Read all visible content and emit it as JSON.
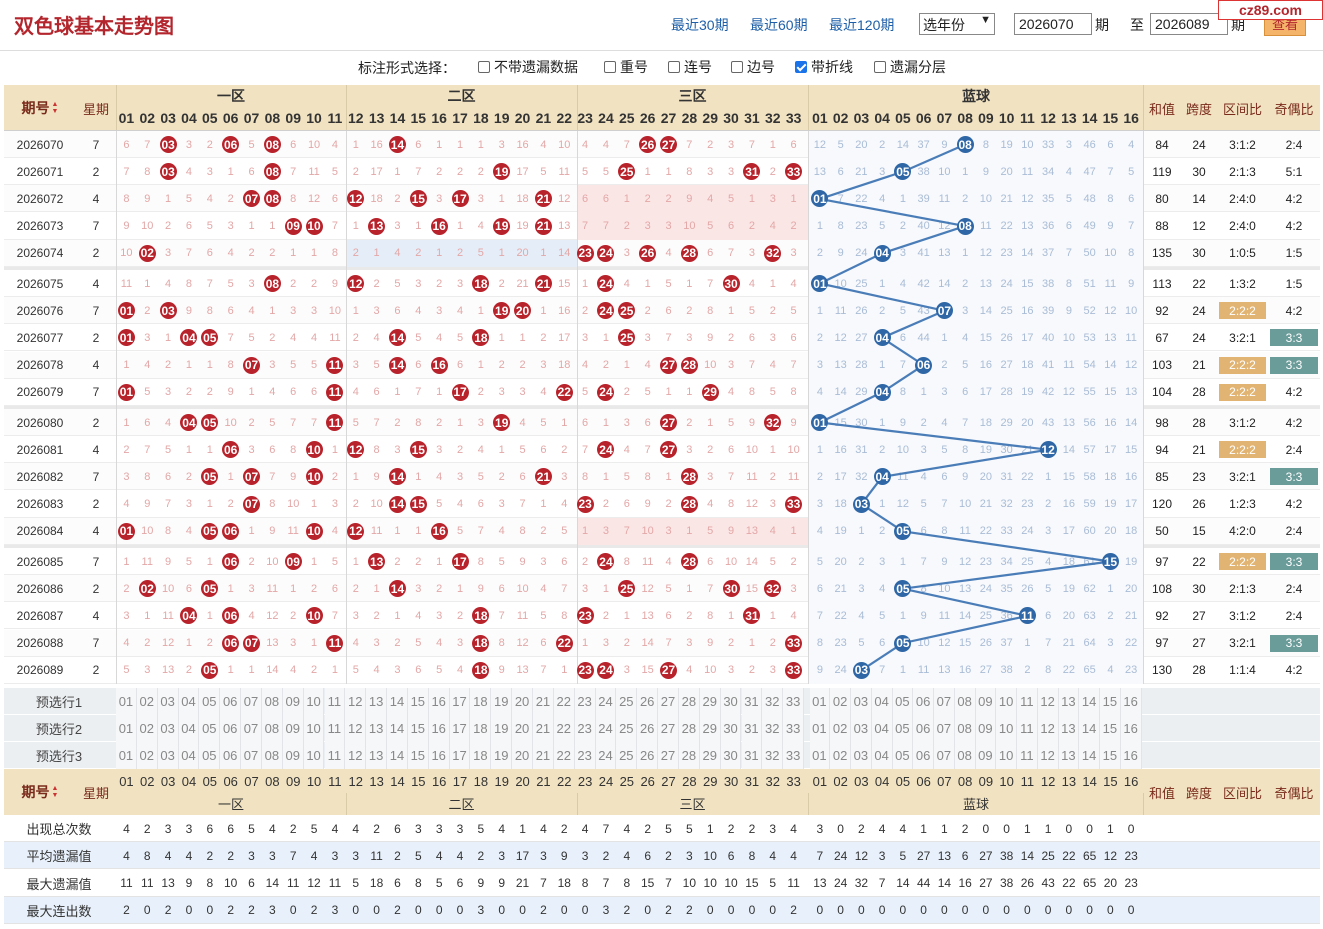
{
  "header": {
    "title": "双色球基本走势图",
    "links": [
      "最近30期",
      "最近60期",
      "最近120期"
    ],
    "year_select": "选年份",
    "from_issue": "2026070",
    "to_issue": "2026089",
    "qi_label": "期",
    "to_label": "至",
    "query_button": "查看",
    "logo": "cz89.com"
  },
  "options": {
    "label": "标注形式选择：",
    "items": [
      {
        "label": "不带遗漏数据",
        "checked": false
      },
      {
        "label": "重号",
        "checked": false
      },
      {
        "label": "连号",
        "checked": false
      },
      {
        "label": "边号",
        "checked": false
      },
      {
        "label": "带折线",
        "checked": true
      },
      {
        "label": "遗漏分层",
        "checked": false
      }
    ]
  },
  "table": {
    "col_issue": "期号",
    "col_week": "星期",
    "zones": [
      "一区",
      "二区",
      "三区",
      "蓝球"
    ],
    "col_sum": "和值",
    "col_span": "跨度",
    "col_ratio": "区间比",
    "col_oddeven": "奇偶比",
    "red_numbers": [
      "01",
      "02",
      "03",
      "04",
      "05",
      "06",
      "07",
      "08",
      "09",
      "10",
      "11",
      "12",
      "13",
      "14",
      "15",
      "16",
      "17",
      "18",
      "19",
      "20",
      "21",
      "22",
      "23",
      "24",
      "25",
      "26",
      "27",
      "28",
      "29",
      "30",
      "31",
      "32",
      "33"
    ],
    "blue_numbers": [
      "01",
      "02",
      "03",
      "04",
      "05",
      "06",
      "07",
      "08",
      "09",
      "10",
      "11",
      "12",
      "13",
      "14",
      "15",
      "16"
    ],
    "rows": [
      {
        "issue": "2026070",
        "week": "7",
        "red": [
          3,
          6,
          8,
          14,
          26,
          27
        ],
        "blue": 8,
        "sum": "84",
        "span": "24",
        "ratio": "3:1:2",
        "oe": "2:4",
        "rm": "6 7 - 3 2 - 5 - 6 10 4 1 16 - 6 1 1 1 3 16 4 10 4 4 7 - - 7 2 3 7 1 6",
        "bm": "12 5 20 2 14 37 9 - 8 19 10 33 3 46 6 4"
      },
      {
        "issue": "2026071",
        "week": "2",
        "red": [
          3,
          8,
          19,
          25,
          31,
          33
        ],
        "blue": 5,
        "sum": "119",
        "span": "30",
        "ratio": "2:1:3",
        "oe": "5:1",
        "rm": "7 8 - 4 3 1 6 - 7 11 5 2 17 1 7 2 2 2 - 17 5 11 5 5 - 1 1 8 3 3 - 2 -",
        "bm": "13 6 21 3 - 38 10 1 9 20 11 34 4 47 7 5"
      },
      {
        "issue": "2026072",
        "week": "4",
        "red": [
          7,
          8,
          12,
          15,
          17,
          21
        ],
        "blue": 1,
        "sum": "80",
        "span": "14",
        "ratio": "2:4:0",
        "oe": "4:2",
        "rm": "8 9 1 5 4 2 - - 8 12 6 - 18 2 - 3 - 3 1 18 - 12 6 6 1 2 2 9 4 5 1 3 1",
        "bm": "- 7 22 4 1 39 11 2 10 21 12 35 5 48 8 6"
      },
      {
        "issue": "2026073",
        "week": "7",
        "red": [
          9,
          10,
          13,
          16,
          19,
          21
        ],
        "blue": 8,
        "sum": "88",
        "span": "12",
        "ratio": "2:4:0",
        "oe": "4:2",
        "rm": "9 10 2 6 5 3 1 1 - - 7 1 - 3 1 - 1 4 - 19 - 13 7 7 2 3 3 10 5 6 2 4 2",
        "bm": "1 8 23 5 2 40 12 - 11 22 13 36 6 49 9 7"
      },
      {
        "issue": "2026074",
        "week": "2",
        "red": [
          2,
          23,
          24,
          26,
          28,
          32
        ],
        "blue": 4,
        "sum": "135",
        "span": "30",
        "ratio": "1:0:5",
        "oe": "1:5",
        "rm": "10 - 3 7 6 4 2 2 1 1 8 2 1 4 2 1 2 5 1 20 1 14 - - 3 - 4 - 6 7 3 - 3",
        "bm": "2 9 24 - 3 41 13 1 12 23 14 37 7 50 10 8"
      },
      {
        "issue": "2026075",
        "week": "4",
        "red": [
          8,
          12,
          18,
          21,
          24,
          30
        ],
        "blue": 1,
        "sum": "113",
        "span": "22",
        "ratio": "1:3:2",
        "oe": "1:5",
        "rm": "11 1 4 8 7 5 3 - 2 2 9 - 2 5 3 2 3 - 2 21 - 15 1 - 4 1 5 1 7 - 4 1 4",
        "bm": "- 10 25 1 4 42 14 2 13 24 15 38 8 51 11 9"
      },
      {
        "issue": "2026076",
        "week": "7",
        "red": [
          1,
          3,
          19,
          20,
          24,
          25
        ],
        "blue": 7,
        "sum": "92",
        "span": "24",
        "ratio": "2:2:2",
        "oe": "4:2",
        "rm": "- 2 - 9 8 6 4 1 3 3 10 1 3 6 4 3 4 1 - - 1 16 2 - - 2 6 2 8 1 5 2 5",
        "bm": "1 11 26 2 5 43 - 3 14 25 16 39 9 52 12 10"
      },
      {
        "issue": "2026077",
        "week": "2",
        "red": [
          1,
          4,
          5,
          14,
          18,
          25
        ],
        "blue": 4,
        "sum": "67",
        "span": "24",
        "ratio": "3:2:1",
        "oe": "3:3",
        "rm": "- 3 1 - - 7 5 2 4 4 11 2 4 - 5 4 5 - 1 1 2 17 3 1 - 3 7 3 9 2 6 3 6",
        "bm": "2 12 27 - 6 44 1 4 15 26 17 40 10 53 13 11"
      },
      {
        "issue": "2026078",
        "week": "4",
        "red": [
          7,
          11,
          14,
          16,
          27,
          28
        ],
        "blue": 6,
        "sum": "103",
        "span": "21",
        "ratio": "2:2:2",
        "oe": "3:3",
        "rm": "1 4 2 1 1 8 - 3 5 5 - 3 5 - 6 - 6 1 2 2 3 18 4 2 1 4 - - 10 3 7 4 7",
        "bm": "3 13 28 1 7 - 2 5 16 27 18 41 11 54 14 12"
      },
      {
        "issue": "2026079",
        "week": "7",
        "red": [
          1,
          11,
          17,
          22,
          24,
          29
        ],
        "blue": 4,
        "sum": "104",
        "span": "28",
        "ratio": "2:2:2",
        "oe": "4:2",
        "rm": "- 5 3 2 2 9 1 4 6 6 - 4 6 1 7 1 - 2 3 3 4 - 5 - 2 5 1 1 - 4 8 5 8",
        "bm": "4 14 29 - 8 1 3 6 17 28 19 42 12 55 15 13"
      },
      {
        "issue": "2026080",
        "week": "2",
        "red": [
          4,
          5,
          11,
          19,
          27,
          32
        ],
        "blue": 1,
        "sum": "98",
        "span": "28",
        "ratio": "3:1:2",
        "oe": "4:2",
        "rm": "1 6 4 - - 10 2 5 7 7 - 5 7 2 8 2 1 3 - 4 5 1 6 1 3 6 - 2 1 5 9 - 9",
        "bm": "- 15 30 1 9 2 4 7 18 29 20 43 13 56 16 14"
      },
      {
        "issue": "2026081",
        "week": "4",
        "red": [
          6,
          10,
          12,
          15,
          24,
          27
        ],
        "blue": 12,
        "sum": "94",
        "span": "21",
        "ratio": "2:2:2",
        "oe": "2:4",
        "rm": "2 7 5 1 1 - 3 6 8 - 1 - 8 3 - 3 2 4 1 5 6 2 7 - 4 7 - 3 2 6 10 1 10",
        "bm": "1 16 31 2 10 3 5 8 19 30 21 - 14 57 17 15"
      },
      {
        "issue": "2026082",
        "week": "7",
        "red": [
          5,
          7,
          10,
          14,
          21,
          28
        ],
        "blue": 4,
        "sum": "85",
        "span": "23",
        "ratio": "3:2:1",
        "oe": "3:3",
        "rm": "3 8 6 2 - 1 - 7 9 - 2 1 9 - 1 4 3 5 2 6 - 3 8 1 5 8 1 - 3 7 11 2 11",
        "bm": "2 17 32 - 11 4 6 9 20 31 22 1 15 58 18 16"
      },
      {
        "issue": "2026083",
        "week": "2",
        "red": [
          7,
          14,
          15,
          23,
          28,
          33
        ],
        "blue": 3,
        "sum": "120",
        "span": "26",
        "ratio": "1:2:3",
        "oe": "4:2",
        "rm": "4 9 7 3 1 2 - 8 10 1 3 2 10 - - 5 4 6 3 7 1 4 - 2 6 9 2 - 4 8 12 3 -",
        "bm": "3 18 - 1 12 5 7 10 21 32 23 2 16 59 19 17"
      },
      {
        "issue": "2026084",
        "week": "4",
        "red": [
          1,
          5,
          6,
          10,
          12,
          16
        ],
        "blue": 5,
        "sum": "50",
        "span": "15",
        "ratio": "4:2:0",
        "oe": "2:4",
        "rm": "- 10 8 4 - - 1 9 11 - 4 - 11 1 1 - 5 7 4 8 2 5 1 3 7 10 3 1 5 9 13 4 1",
        "bm": "4 19 1 2 - 6 8 11 22 33 24 3 17 60 20 18"
      },
      {
        "issue": "2026085",
        "week": "7",
        "red": [
          6,
          9,
          13,
          17,
          24,
          28
        ],
        "blue": 15,
        "sum": "97",
        "span": "22",
        "ratio": "2:2:2",
        "oe": "3:3",
        "rm": "1 11 9 5 1 - 2 10 - 1 5 1 - 2 2 1 - 8 5 9 3 6 2 - 8 11 4 - 6 10 14 5 2",
        "bm": "5 20 2 3 1 7 9 12 23 34 25 4 18 61 - 19"
      },
      {
        "issue": "2026086",
        "week": "2",
        "red": [
          2,
          5,
          14,
          25,
          30,
          32
        ],
        "blue": 5,
        "sum": "108",
        "span": "30",
        "ratio": "2:1:3",
        "oe": "2:4",
        "rm": "2 - 10 6 - 1 3 11 1 2 6 2 1 - 3 2 1 9 6 10 4 7 3 1 - 12 5 1 7 - 15 - 3",
        "bm": "6 21 3 4 - 8 10 13 24 35 26 5 19 62 1 20"
      },
      {
        "issue": "2026087",
        "week": "4",
        "red": [
          4,
          6,
          10,
          18,
          23,
          31
        ],
        "blue": 11,
        "sum": "92",
        "span": "27",
        "ratio": "3:1:2",
        "oe": "2:4",
        "rm": "3 1 11 - 1 - 4 12 2 - 7 3 2 1 4 3 2 - 7 11 5 8 - 2 1 13 6 2 8 1 - 1 4",
        "bm": "7 22 4 5 1 9 11 14 25 36 - 6 20 63 2 21"
      },
      {
        "issue": "2026088",
        "week": "7",
        "red": [
          6,
          7,
          11,
          18,
          22,
          33
        ],
        "blue": 5,
        "sum": "97",
        "span": "27",
        "ratio": "3:2:1",
        "oe": "3:3",
        "rm": "4 2 12 1 2 - - 13 3 1 - 4 3 2 5 4 3 - 8 12 6 - 1 3 2 14 7 3 9 2 1 2 -",
        "bm": "8 23 5 6 - 10 12 15 26 37 1 7 21 64 3 22"
      },
      {
        "issue": "2026089",
        "week": "2",
        "red": [
          5,
          18,
          23,
          24,
          27,
          33
        ],
        "blue": 3,
        "sum": "130",
        "span": "28",
        "ratio": "1:1:4",
        "oe": "4:2",
        "rm": "5 3 13 2 - 1 1 14 4 2 1 5 4 3 6 5 4 - 9 13 7 1 - - 3 15 - 4 10 3 2 3 -",
        "bm": "9 24 - 7 1 11 13 16 27 38 2 8 22 65 4 23"
      }
    ],
    "preselect_labels": [
      "预选行1",
      "预选行2",
      "预选行3"
    ],
    "stats": [
      {
        "label": "出现总次数",
        "red": "4 2 3 3 6 6 5 4 2 5 4 4 2 6 3 3 3 5 4 1 4 2 4 7 4 2 5 5 1 2 2 3 4",
        "blue": "3 0 2 4 4 1 1 2 0 0 1 1 0 0 1 0"
      },
      {
        "label": "平均遗漏值",
        "red": "4 8 4 4 2 2 3 3 7 4 3 3 11 2 5 4 4 2 3 17 3 9 3 2 4 6 2 3 10 6 8 4 4",
        "blue": "7 24 12 3 5 27 13 6 27 38 14 25 22 65 12 23"
      },
      {
        "label": "最大遗漏值",
        "red": "11 11 13 9 8 10 6 14 11 12 11 5 18 6 8 5 6 9 9 21 7 18 8 7 8 15 7 10 10 10 15 5 11",
        "blue": "13 24 32 7 14 44 14 16 27 38 26 43 22 65 20 23"
      },
      {
        "label": "最大连出数",
        "red": "2 0 2 0 0 2 2 3 0 2 3 0 0 2 0 0 0 3 0 0 2 0 0 3 2 0 2 2 0 0 0 0 2",
        "blue": "0 0 0 0 0 0 0 0 0 0 0 0 0 0 0 0"
      }
    ]
  },
  "colors": {
    "red_ball": "#b8222b",
    "blue_ball": "#2f67a6",
    "header_bg": "#f1e3c2",
    "ratio_highlight": "#e2b473",
    "oe_highlight": "#6a9c9a",
    "link": "#1d5fa8"
  }
}
